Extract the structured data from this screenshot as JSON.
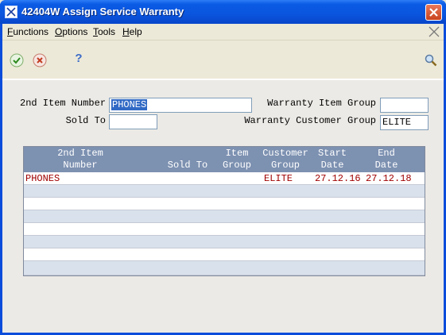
{
  "window": {
    "title": "42404W   Assign Service Warranty"
  },
  "menu": {
    "items": [
      {
        "label_u": "F",
        "label_rest": "unctions"
      },
      {
        "label_u": "O",
        "label_rest": "ptions"
      },
      {
        "label_u": "T",
        "label_rest": "ools"
      },
      {
        "label_u": "H",
        "label_rest": "elp"
      }
    ]
  },
  "toolbar": {
    "ok": "ok-check-icon",
    "cancel": "cancel-x-icon",
    "help": "?",
    "find": "search-icon"
  },
  "form": {
    "item_number_label": "2nd Item Number",
    "item_number_value": "PHONES",
    "sold_to_label": "Sold To",
    "sold_to_value": "",
    "warranty_item_group_label": "Warranty Item Group",
    "warranty_item_group_value": "",
    "warranty_customer_group_label": "Warranty Customer Group",
    "warranty_customer_group_value": "ELITE"
  },
  "grid": {
    "headers": {
      "item_1": "2nd Item",
      "item_2": "Number",
      "sold_to": "Sold To",
      "item_group_1": "Item",
      "item_group_2": "Group",
      "cust_group_1": "Customer",
      "cust_group_2": "Group",
      "start_1": "Start",
      "start_2": "Date",
      "end_1": "End",
      "end_2": "Date"
    },
    "rows": [
      {
        "item": "PHONES",
        "sold_to": "",
        "item_group": "",
        "cust_group": "ELITE",
        "start": "27.12.16",
        "end": "27.12.18"
      }
    ]
  }
}
